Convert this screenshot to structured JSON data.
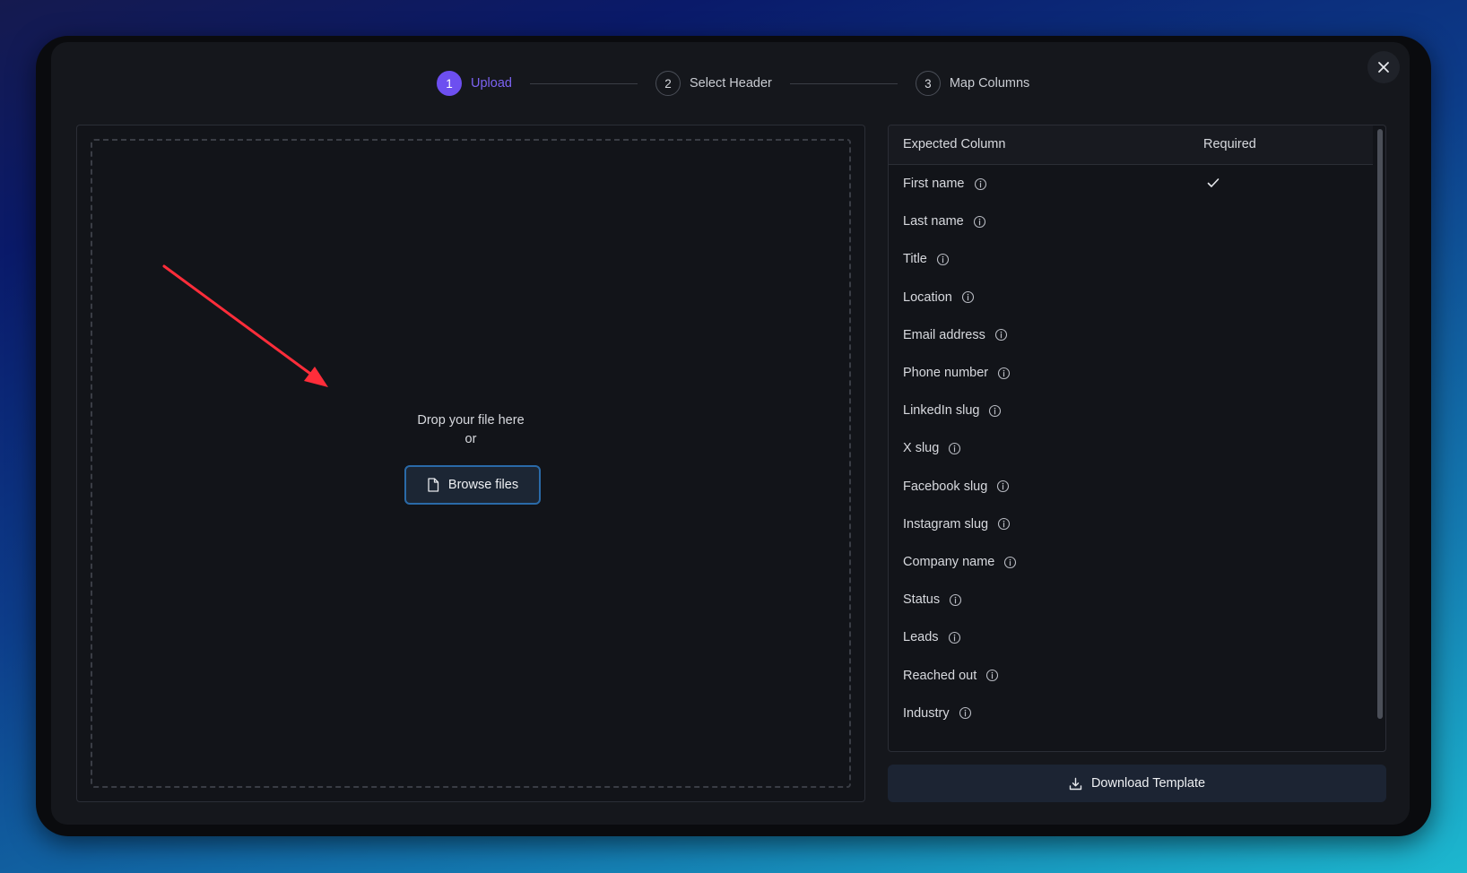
{
  "stepper": {
    "steps": [
      {
        "number": "1",
        "label": "Upload",
        "active": true
      },
      {
        "number": "2",
        "label": "Select Header",
        "active": false
      },
      {
        "number": "3",
        "label": "Map Columns",
        "active": false
      }
    ]
  },
  "close_icon": "close-icon",
  "upload": {
    "drop_text": "Drop your file here",
    "or_text": "or",
    "browse_label": "Browse files",
    "browse_icon": "file-icon"
  },
  "columns_table": {
    "headers": {
      "expected": "Expected Column",
      "required": "Required"
    },
    "rows": [
      {
        "name": "First name",
        "required": true
      },
      {
        "name": "Last name",
        "required": false
      },
      {
        "name": "Title",
        "required": false
      },
      {
        "name": "Location",
        "required": false
      },
      {
        "name": "Email address",
        "required": false
      },
      {
        "name": "Phone number",
        "required": false
      },
      {
        "name": "LinkedIn slug",
        "required": false
      },
      {
        "name": "X slug",
        "required": false
      },
      {
        "name": "Facebook slug",
        "required": false
      },
      {
        "name": "Instagram slug",
        "required": false
      },
      {
        "name": "Company name",
        "required": false
      },
      {
        "name": "Status",
        "required": false
      },
      {
        "name": "Leads",
        "required": false
      },
      {
        "name": "Reached out",
        "required": false
      },
      {
        "name": "Industry",
        "required": false
      }
    ]
  },
  "download": {
    "label": "Download Template",
    "icon": "download-icon"
  },
  "colors": {
    "accent": "#6d4ff0",
    "arrow": "#ff2d3a",
    "browse_border": "#2a6aa8"
  }
}
